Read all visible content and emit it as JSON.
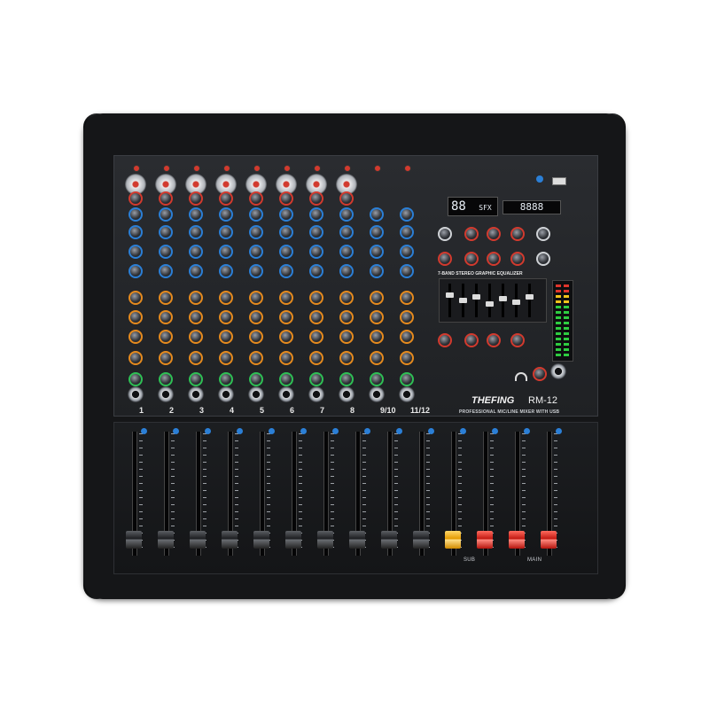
{
  "product": {
    "brand": "THEFING",
    "model": "RM-12",
    "tagline": "PROFESSIONAL MIC/LINE MIXER WITH USB"
  },
  "eq": {
    "title": "7-BAND STEREO GRAPHIC EQUALIZER",
    "bands": 7
  },
  "effects_display": {
    "digits": "88",
    "logo": "SFX"
  },
  "usb_display": {
    "text": "8888"
  },
  "channels": [
    "1",
    "2",
    "3",
    "4",
    "5",
    "6",
    "7",
    "8",
    "9/10",
    "11/12"
  ],
  "bus_faders": [
    "SUB",
    "SUB",
    "MAIN",
    "MAIN"
  ],
  "colors": {
    "eq_knob": "#2b7fd6",
    "aux_knob": "#e58a1e",
    "pan_knob": "#2fbf55",
    "bus_fader_cap": "#d23a2e",
    "master_cap": "#e39a00"
  }
}
